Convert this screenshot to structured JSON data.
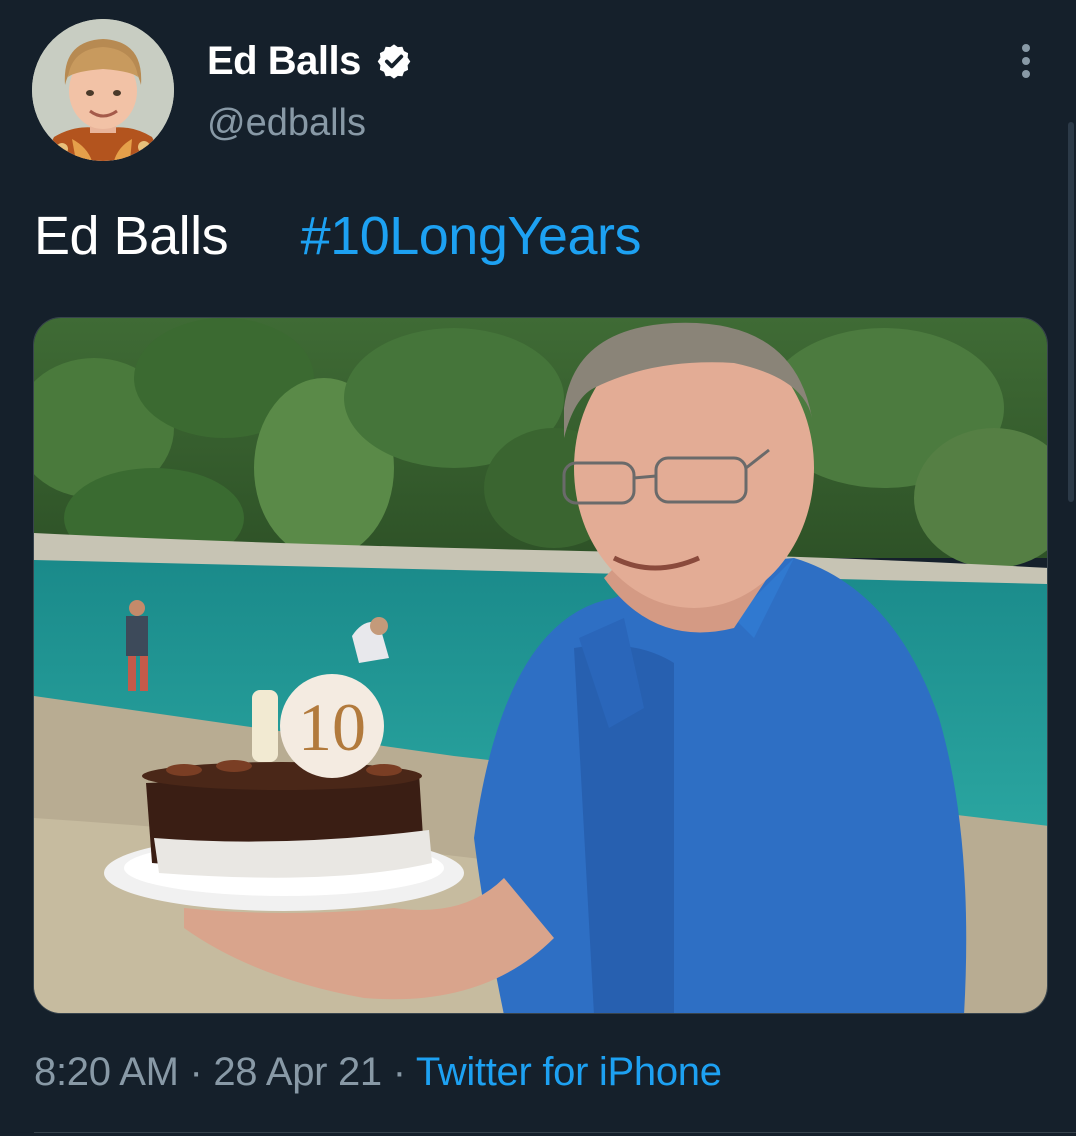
{
  "author": {
    "display_name": "Ed Balls",
    "handle": "@edballs",
    "verified": true,
    "avatar_icon": "child-portrait-avatar"
  },
  "tweet": {
    "text_plain": "Ed Balls",
    "text_gap": "     ",
    "hashtag": "#10LongYears",
    "media": {
      "icon": "photo-man-holding-birthday-cake",
      "candle_number": "10"
    }
  },
  "meta": {
    "time": "8:20 AM",
    "separator": " · ",
    "date": "28 Apr 21",
    "source": "Twitter for iPhone"
  },
  "colors": {
    "background": "#15202b",
    "accent": "#1da1f2",
    "secondary_text": "#8899a6"
  }
}
